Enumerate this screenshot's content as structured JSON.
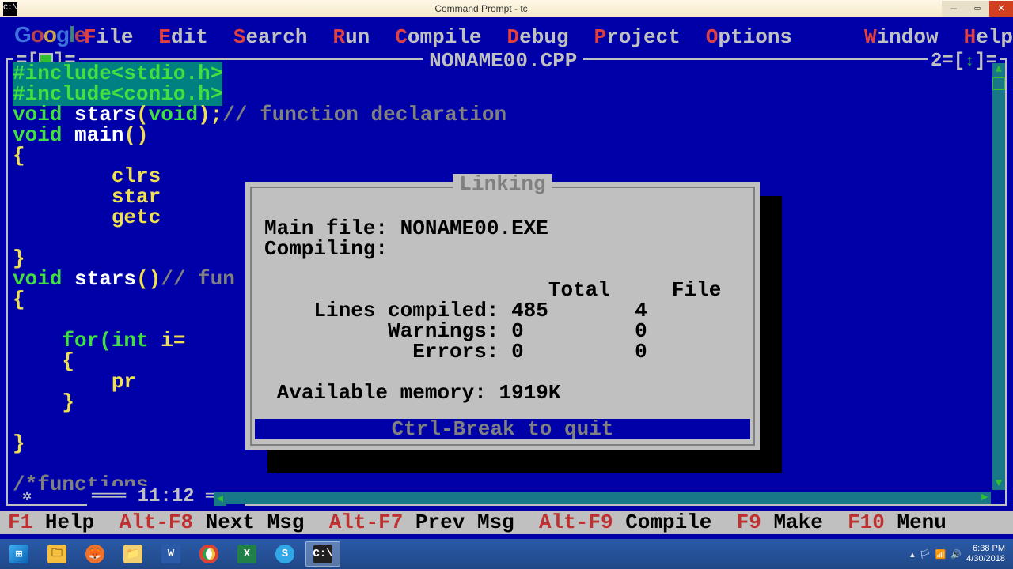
{
  "window": {
    "title": "Command Prompt - tc"
  },
  "menu": {
    "file": "File",
    "edit": "Edit",
    "search": "Search",
    "run": "Run",
    "compile": "Compile",
    "debug": "Debug",
    "project": "Project",
    "options": "Options",
    "window_m": "Window",
    "help": "Help"
  },
  "editor": {
    "filename": "NONAME00.CPP",
    "window_number": "2",
    "cursor_position": "11:12"
  },
  "code": {
    "l1_inc1": "#include<stdio.h>",
    "l2_inc2": "#include<conio.h>",
    "l3_a": "void ",
    "l3_b": "stars",
    "l3_c": "(",
    "l3_d": "void",
    "l3_e": ");",
    "l3_f": "// function declaration",
    "l4_a": "void ",
    "l4_b": "main",
    "l4_c": "()",
    "l5": "{",
    "l6": "        clrs",
    "l7": "        star",
    "l8": "        getc",
    "l9": "",
    "l10": "}",
    "l11_a": "void ",
    "l11_b": "stars",
    "l11_c": "()",
    "l11_d": "// fun",
    "l12": "{",
    "l13": "",
    "l14_a": "    for(",
    "l14_b": "int",
    "l14_c": " i=",
    "l15": "    {",
    "l16": "        pr",
    "l17": "    }",
    "l18": "",
    "l19": "}",
    "l20": "",
    "l21": "/*functions"
  },
  "dialog": {
    "title": "Linking",
    "main_file_label": "Main file: ",
    "main_file_value": "NONAME00.EXE",
    "compiling_label": "Compiling:",
    "total_header": "Total",
    "file_header": "File",
    "lines_label": "Lines compiled:",
    "lines_total": "485",
    "lines_file": "4",
    "warnings_label": "Warnings:",
    "warnings_total": "0",
    "warnings_file": "0",
    "errors_label": "Errors:",
    "errors_total": "0",
    "errors_file": "0",
    "memory_label": "Available memory: ",
    "memory_value": "1919K",
    "quit_hint": "Ctrl-Break to quit"
  },
  "status": {
    "f1_key": "F1",
    "f1_lbl": " Help  ",
    "altf8_key": "Alt-F8",
    "altf8_lbl": " Next Msg  ",
    "altf7_key": "Alt-F7",
    "altf7_lbl": " Prev Msg  ",
    "altf9_key": "Alt-F9",
    "altf9_lbl": " Compile  ",
    "f9_key": "F9",
    "f9_lbl": " Make  ",
    "f10_key": "F10",
    "f10_lbl": " Menu"
  },
  "taskbar": {
    "time": "6:38 PM",
    "date": "4/30/2018"
  }
}
